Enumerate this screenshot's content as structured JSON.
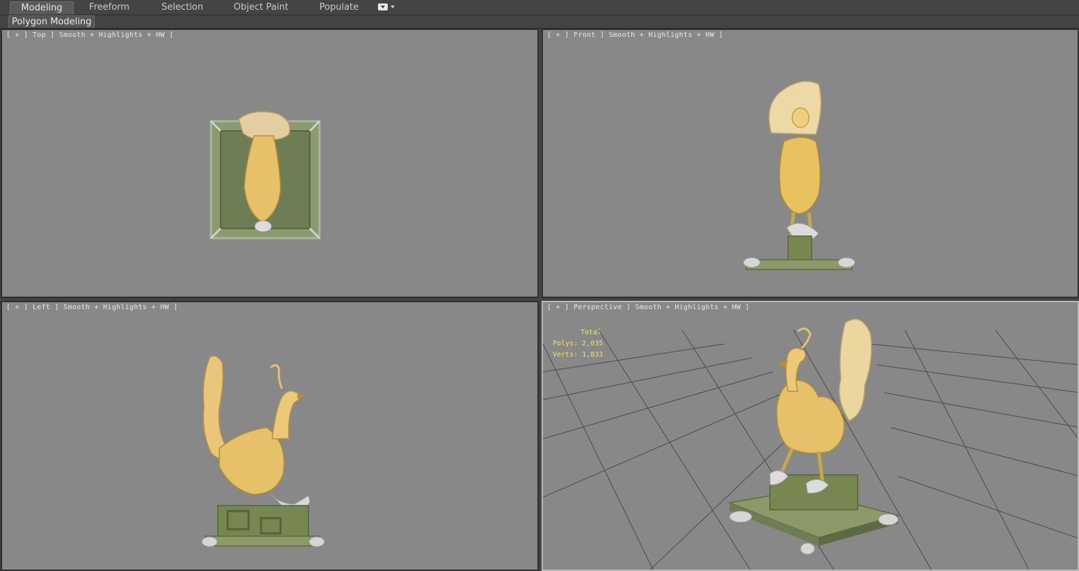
{
  "ribbon": {
    "tabs": [
      {
        "label": "Modeling",
        "active": true
      },
      {
        "label": "Freeform",
        "active": false
      },
      {
        "label": "Selection",
        "active": false
      },
      {
        "label": "Object Paint",
        "active": false
      },
      {
        "label": "Populate",
        "active": false
      }
    ],
    "panel_label": "Polygon Modeling"
  },
  "viewports": {
    "top": {
      "label": "[ + ] Top ] Smooth + Highlights + HW ]"
    },
    "front": {
      "label": "[ + ] Front ] Smooth + Highlights + HW ]"
    },
    "left": {
      "label": "[ + ] Left ] Smooth + Highlights + HW ]"
    },
    "perspective": {
      "label": "[ + ] Perspective ] Smooth + Highlights + HW ]",
      "stats": {
        "total_label": "Total",
        "polys": "Polys: 2,035",
        "verts": "Verts: 1,833"
      }
    }
  },
  "colors": {
    "viewport_bg": "#888888",
    "gold": "#e8c877",
    "jade": "#7d8a5a",
    "stats_text": "#f2e64b"
  }
}
